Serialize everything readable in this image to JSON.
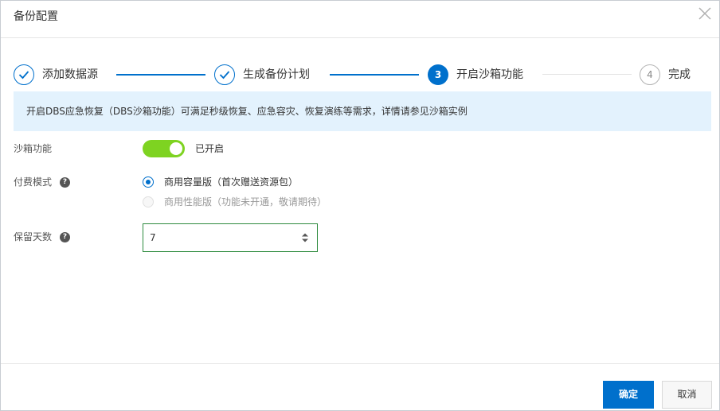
{
  "dialog": {
    "title": "备份配置",
    "close_icon": "close-icon"
  },
  "steps": [
    {
      "label": "添加数据源",
      "status": "done",
      "icon": "check-icon"
    },
    {
      "label": "生成备份计划",
      "status": "done",
      "icon": "check-icon"
    },
    {
      "number": "3",
      "label": "开启沙箱功能",
      "status": "active"
    },
    {
      "number": "4",
      "label": "完成",
      "status": "todo"
    }
  ],
  "notice": {
    "text": "开启DBS应急恢复（DBS沙箱功能）可满足秒级恢复、应急容灾、恢复演练等需求，详情请参见沙箱实例"
  },
  "sandbox": {
    "label": "沙箱功能",
    "enabled": true,
    "status_text": "已开启"
  },
  "billing": {
    "label": "付费模式",
    "help_icon": "help-icon",
    "options": [
      {
        "label": "商用容量版（首次赠送资源包）",
        "checked": true,
        "disabled": false
      },
      {
        "label": "商用性能版（功能未开通，敬请期待）",
        "checked": false,
        "disabled": true
      }
    ]
  },
  "retention": {
    "label": "保留天数",
    "help_icon": "help-icon",
    "value": "7"
  },
  "footer": {
    "confirm_label": "确定",
    "cancel_label": "取消"
  },
  "colors": {
    "primary": "#0070cc",
    "switch_on": "#7ed321",
    "notice_bg": "#e3f2fd",
    "input_border": "#2e8b3e"
  }
}
